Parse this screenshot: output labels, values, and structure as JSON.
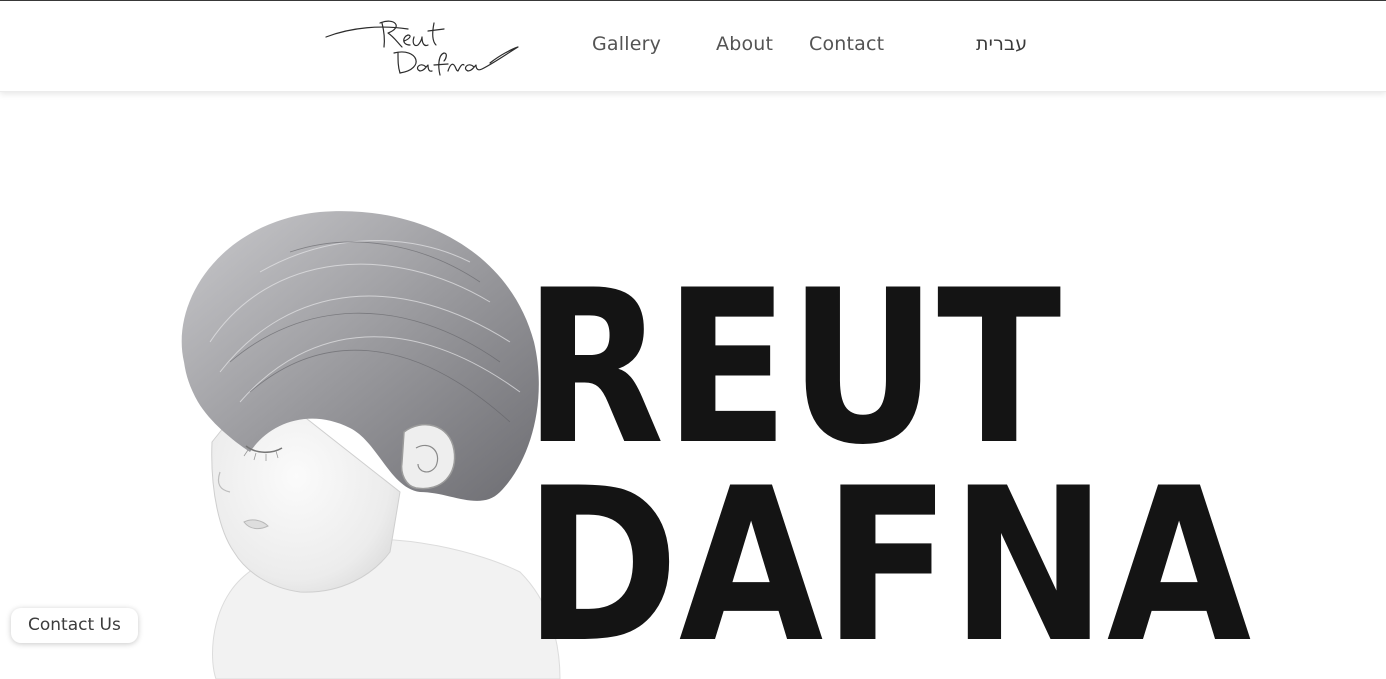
{
  "header": {
    "logo_text": "Reut Dafna",
    "nav": {
      "gallery": "Gallery",
      "about": "About",
      "contact": "Contact",
      "language": "עברית"
    }
  },
  "hero": {
    "title_line_1": "REUT",
    "title_line_2": "DAFNA",
    "image_subject": "pencil drawing of a child with closed eyes"
  },
  "floating": {
    "contact_us_label": "Contact Us"
  },
  "colors": {
    "background": "#ffffff",
    "nav_text": "#545454",
    "title_text": "#141414"
  }
}
